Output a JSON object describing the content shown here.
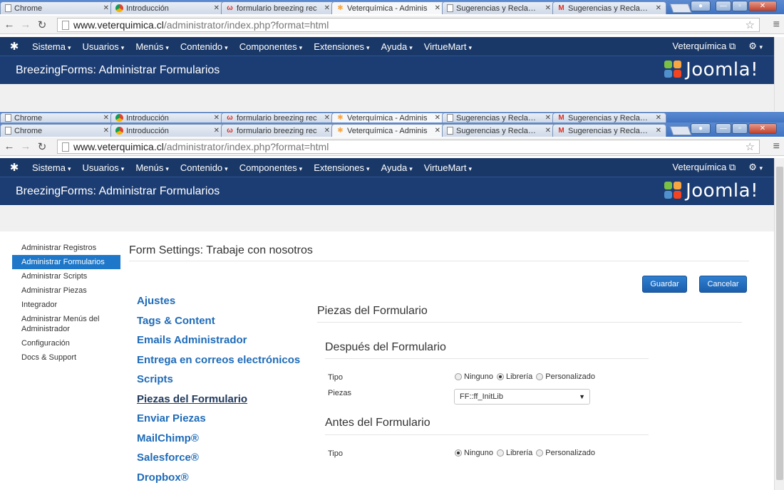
{
  "browser": {
    "tabs": [
      {
        "icon": "doc-icon",
        "title": "Chrome"
      },
      {
        "icon": "chrome-icon",
        "title": "Introducción"
      },
      {
        "icon": "w-icon",
        "title": "formulario breezing rec"
      },
      {
        "icon": "joomla-icon",
        "title": "Veterquímica - Adminis"
      },
      {
        "icon": "doc-icon",
        "title": "Sugerencias y Reclamos"
      },
      {
        "icon": "gmail-icon",
        "title": "Sugerencias y Reclamos"
      }
    ],
    "url_host": "www.veterquimica.cl",
    "url_path": "/administrator/index.php?format=html"
  },
  "joomla": {
    "menu": [
      "Sistema",
      "Usuarios",
      "Menús",
      "Contenido",
      "Componentes",
      "Extensiones",
      "Ayuda",
      "VirtueMart"
    ],
    "site_link": "Veterquímica",
    "page_title": "BreezingForms: Administrar Formularios",
    "brand": "Joomla!"
  },
  "sidebar": [
    {
      "label": "Administrar Registros",
      "active": false
    },
    {
      "label": "Administrar Formularios",
      "active": true
    },
    {
      "label": "Administrar Scripts",
      "active": false
    },
    {
      "label": "Administrar Piezas",
      "active": false
    },
    {
      "label": "Integrador",
      "active": false
    },
    {
      "label": "Administrar Menús del Administrador",
      "active": false
    },
    {
      "label": "Configuración",
      "active": false
    },
    {
      "label": "Docs & Support",
      "active": false
    }
  ],
  "form": {
    "title": "Form Settings: Trabaje con nosotros",
    "save": "Guardar",
    "cancel": "Cancelar",
    "nav": [
      "Ajustes",
      "Tags & Content",
      "Emails Administrador",
      "Entrega en correos electrónicos",
      "Scripts",
      "Piezas del Formulario",
      "Enviar Piezas",
      "MailChimp®",
      "Salesforce®",
      "Dropbox®"
    ],
    "current_nav": "Piezas del Formulario",
    "section_title": "Piezas del Formulario",
    "after": {
      "title": "Después del Formulario",
      "tipo_label": "Tipo",
      "options": [
        "Ninguno",
        "Librería",
        "Personalizado"
      ],
      "selected": "Librería",
      "piezas_label": "Piezas",
      "piezas_value": "FF::ff_InitLib"
    },
    "before": {
      "title": "Antes del Formulario",
      "tipo_label": "Tipo",
      "options": [
        "Ninguno",
        "Librería",
        "Personalizado"
      ],
      "selected": "Ninguno"
    }
  }
}
